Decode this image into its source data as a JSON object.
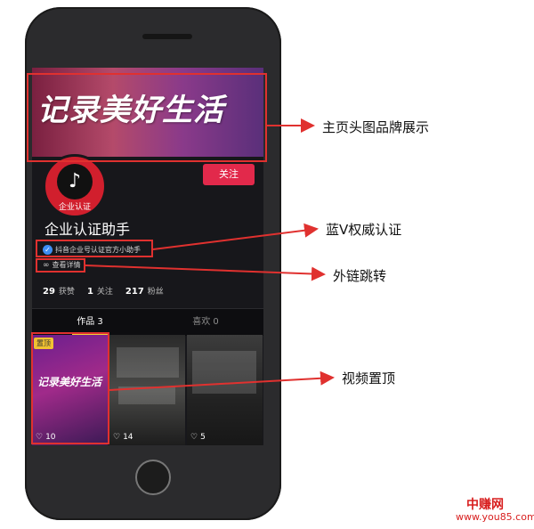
{
  "profile": {
    "banner_text": "记录美好生活",
    "avatar_label": "企业认证",
    "follow_label": "关注",
    "account_name": "企业认证助手",
    "verify_text": "抖音企业号认证官方小助手",
    "link_text": "查看详情"
  },
  "stats": [
    {
      "value": "29",
      "label": "获赞"
    },
    {
      "value": "1",
      "label": "关注"
    },
    {
      "value": "217",
      "label": "粉丝"
    }
  ],
  "tabs": [
    {
      "label": "作品 3",
      "active": true
    },
    {
      "label": "喜欢 0",
      "active": false
    }
  ],
  "videos": [
    {
      "badge": "置顶",
      "title": "记录美好生活",
      "likes": "10"
    },
    {
      "likes": "14"
    },
    {
      "likes": "5"
    }
  ],
  "callouts": {
    "banner": "主页头图品牌展示",
    "verify": "蓝V权威认证",
    "link": "外链跳转",
    "pin": "视频置顶"
  },
  "watermark": {
    "site_name": "中赚网",
    "url": "www.you85.com"
  },
  "colors": {
    "follow_button": "#e2294b",
    "callout_red": "#e0312f",
    "verify_blue": "#3f8ef3",
    "pin_yellow": "#f1c232"
  },
  "icons": [
    "tiktok-logo-icon",
    "verified-check-icon",
    "link-icon",
    "heart-icon"
  ]
}
